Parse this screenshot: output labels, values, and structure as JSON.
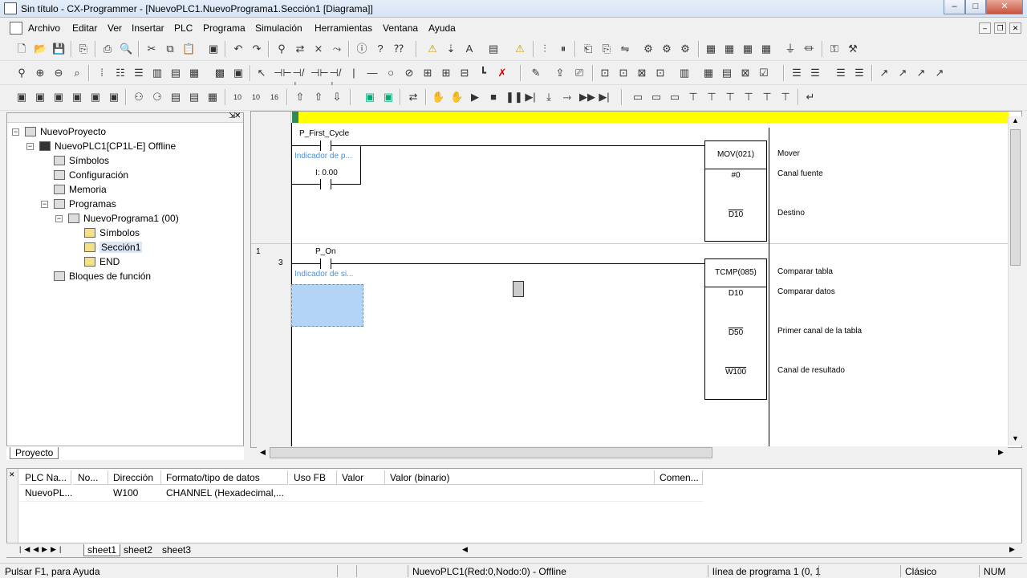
{
  "window": {
    "title": "Sin título - CX-Programmer - [NuevoPLC1.NuevoPrograma1.Sección1 [Diagrama]]"
  },
  "menu": [
    "Archivo",
    "Editar",
    "Ver",
    "Insertar",
    "PLC",
    "Programa",
    "Simulación",
    "Herramientas",
    "Ventana",
    "Ayuda"
  ],
  "tree": {
    "root": "NuevoProyecto",
    "plc": "NuevoPLC1[CP1L-E] Offline",
    "symbols": "Símbolos",
    "config": "Configuración",
    "memory": "Memoria",
    "programs": "Programas",
    "program": "NuevoPrograma1 (00)",
    "prog_symbols": "Símbolos",
    "section": "Sección1",
    "end": "END",
    "function_blocks": "Bloques de función",
    "tab": "Proyecto"
  },
  "ladder": {
    "rung1": {
      "contact1": "P_First_Cycle",
      "comment1": "Indicador de p...",
      "contact2": "I: 0.00",
      "instr": "MOV(021)",
      "op1": "#0",
      "op2": "D10",
      "desc0": "Mover",
      "desc1": "Canal fuente",
      "desc2": "Destino"
    },
    "rung2": {
      "rung_no": "1",
      "step": "3",
      "contact1": "P_On",
      "comment1": "Indicador de si...",
      "instr": "TCMP(085)",
      "op1": "D10",
      "op2": "D50",
      "op3": "W100",
      "desc0": "Comparar tabla",
      "desc1": "Comparar datos",
      "desc2": "Primer canal de la tabla",
      "desc3": "Canal de resultado"
    }
  },
  "watch": {
    "columns": [
      "PLC Na...",
      "No...",
      "Dirección",
      "Formato/tipo de datos",
      "Uso FB",
      "Valor",
      "Valor (binario)",
      "Comen..."
    ],
    "rows": [
      [
        "NuevoPL...",
        "",
        "W100",
        "CHANNEL (Hexadecimal,...",
        "",
        "",
        "",
        ""
      ]
    ],
    "sheets": [
      "sheet1",
      "sheet2",
      "sheet3"
    ]
  },
  "status": {
    "help": "Pulsar F1, para Ayuda",
    "plc": "NuevoPLC1(Red:0,Nodo:0) - Offline",
    "line": "línea de programa 1 (0, 1",
    "mode": "Clásico",
    "num": "NUM"
  }
}
